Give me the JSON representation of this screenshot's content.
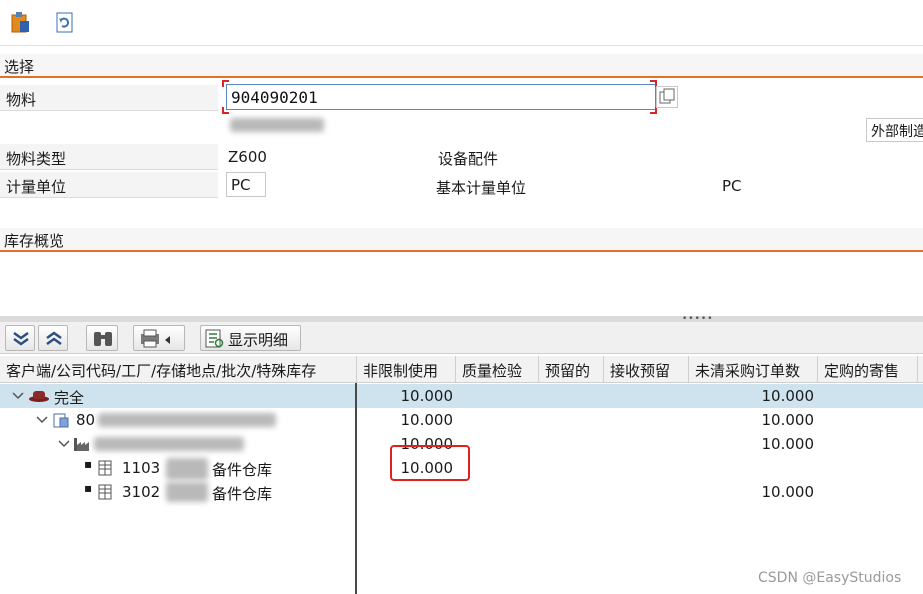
{
  "toolbar": {
    "icons": [
      "clipboard-icon",
      "refresh-icon"
    ]
  },
  "selection": {
    "title": "选择",
    "material_label": "物料",
    "material_value": "904090201",
    "material_type_label": "物料类型",
    "material_type_value": "Z600",
    "material_type_desc": "设备配件",
    "unit_label": "计量单位",
    "unit_value": "PC",
    "base_unit_label": "基本计量单位",
    "base_unit_value": "PC",
    "external_button": "外部制造"
  },
  "overview": {
    "title": "库存概览"
  },
  "alv_toolbar": {
    "detail_button": "显示明细"
  },
  "grid": {
    "columns": [
      "客户端/公司代码/工厂/存储地点/批次/特殊库存",
      "非限制使用",
      "质量检验",
      "预留的",
      "接收预留",
      "未清采购订单数",
      "定购的寄售"
    ],
    "rows": [
      {
        "label": "完全",
        "unrestricted": "10.000",
        "open_po": "10.000"
      },
      {
        "label": "80",
        "unrestricted": "10.000",
        "open_po": "10.000"
      },
      {
        "label": "",
        "unrestricted": "10.000",
        "open_po": "10.000"
      },
      {
        "label_code": "1103",
        "label_suffix": "备件仓库",
        "unrestricted": "10.000",
        "open_po": ""
      },
      {
        "label_code": "3102",
        "label_suffix": "备件仓库",
        "unrestricted": "",
        "open_po": "10.000"
      }
    ]
  },
  "watermark": "CSDN @EasyStudios"
}
